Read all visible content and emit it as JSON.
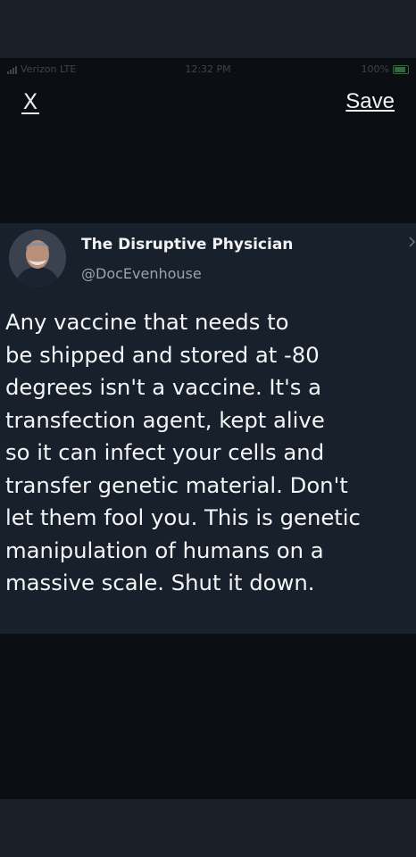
{
  "status_bar": {
    "carrier": "Verizon LTE",
    "time": "12:32 PM",
    "battery": "100%"
  },
  "nav": {
    "close_label": "X",
    "save_label": "Save"
  },
  "tweet": {
    "display_name": "The Disruptive Physician",
    "handle": "@DocEvenhouse",
    "body_lines": [
      "Any vaccine that needs to",
      "be shipped and stored at -80",
      "degrees isn't a vaccine. It's a",
      "transfection agent, kept alive",
      "so it can infect your cells and",
      "transfer genetic material. Don't",
      "let them fool you. This is genetic",
      "manipulation of humans on a",
      "massive scale. Shut it down."
    ]
  }
}
